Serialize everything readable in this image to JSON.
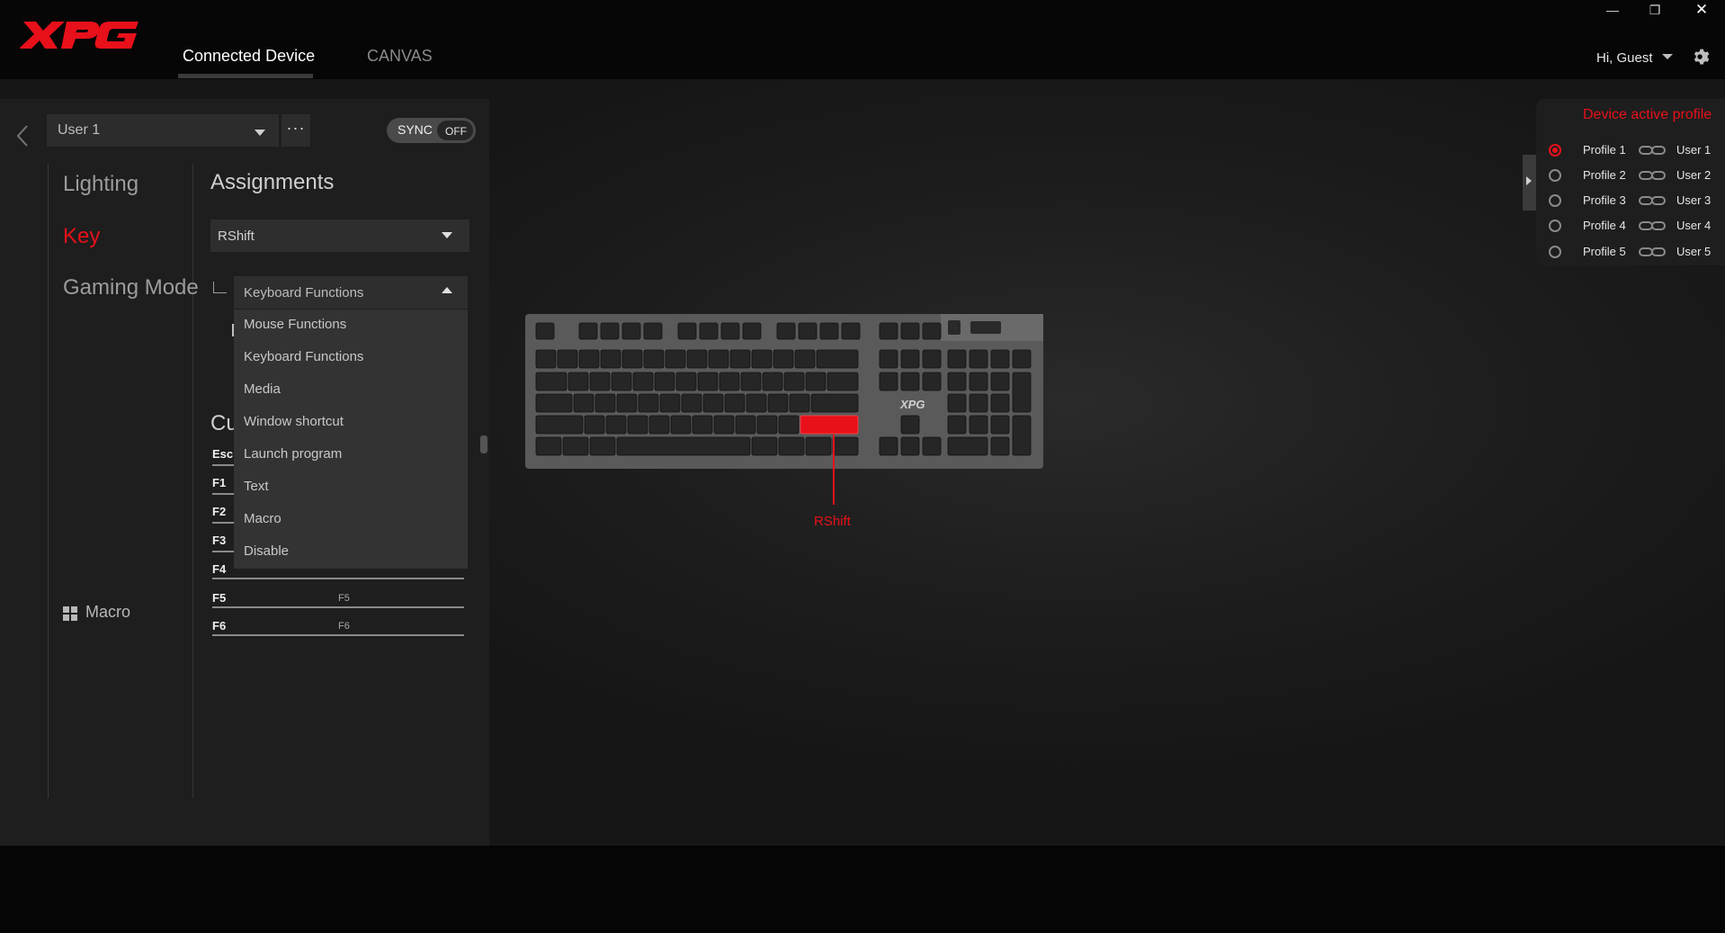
{
  "header": {
    "logo_text": "XPG",
    "tabs": [
      {
        "label": "Connected Device"
      },
      {
        "label": "CANVAS"
      }
    ],
    "greeting": "Hi, Guest",
    "icons": [
      "close-icon",
      "restore-icon",
      "minimize-icon",
      "gear-icon",
      "chevron-down-icon"
    ]
  },
  "left_panel": {
    "profile_select": {
      "value": "User 1"
    },
    "more_label": "···",
    "sync": {
      "label": "SYNC",
      "state": "OFF"
    },
    "categories": [
      {
        "label": "Lighting"
      },
      {
        "label": "Key"
      },
      {
        "label": "Gaming Mode"
      }
    ],
    "macro_label": "Macro",
    "assignments": {
      "title": "Assignments",
      "key_select_value": "RShift",
      "function_select_value": "Keyboard Functions",
      "function_menu": [
        "Mouse Functions",
        "Keyboard Functions",
        "Media",
        "Window shortcut",
        "Launch program",
        "Text",
        "Macro",
        "Disable"
      ],
      "partial_heading": "Cu",
      "rows": [
        {
          "key": "Esc",
          "value": ""
        },
        {
          "key": "F1",
          "value": ""
        },
        {
          "key": "F2",
          "value": ""
        },
        {
          "key": "F3",
          "value": ""
        },
        {
          "key": "F4",
          "value": ""
        },
        {
          "key": "F5",
          "value": "F5"
        },
        {
          "key": "F6",
          "value": "F6"
        }
      ]
    }
  },
  "keyboard": {
    "brand": "XPG",
    "selected_key_callout": "RShift",
    "accent_color": "#e8101a"
  },
  "profile_panel": {
    "title": "Device active profile",
    "profiles": [
      {
        "name": "Profile 1",
        "user": "User 1",
        "active": true
      },
      {
        "name": "Profile 2",
        "user": "User 2",
        "active": false
      },
      {
        "name": "Profile 3",
        "user": "User 3",
        "active": false
      },
      {
        "name": "Profile 4",
        "user": "User 4",
        "active": false
      },
      {
        "name": "Profile 5",
        "user": "User 5",
        "active": false
      }
    ]
  },
  "colors": {
    "accent": "#e8101a",
    "panel_bg": "#1e1e1e",
    "header_bg": "#060606"
  }
}
